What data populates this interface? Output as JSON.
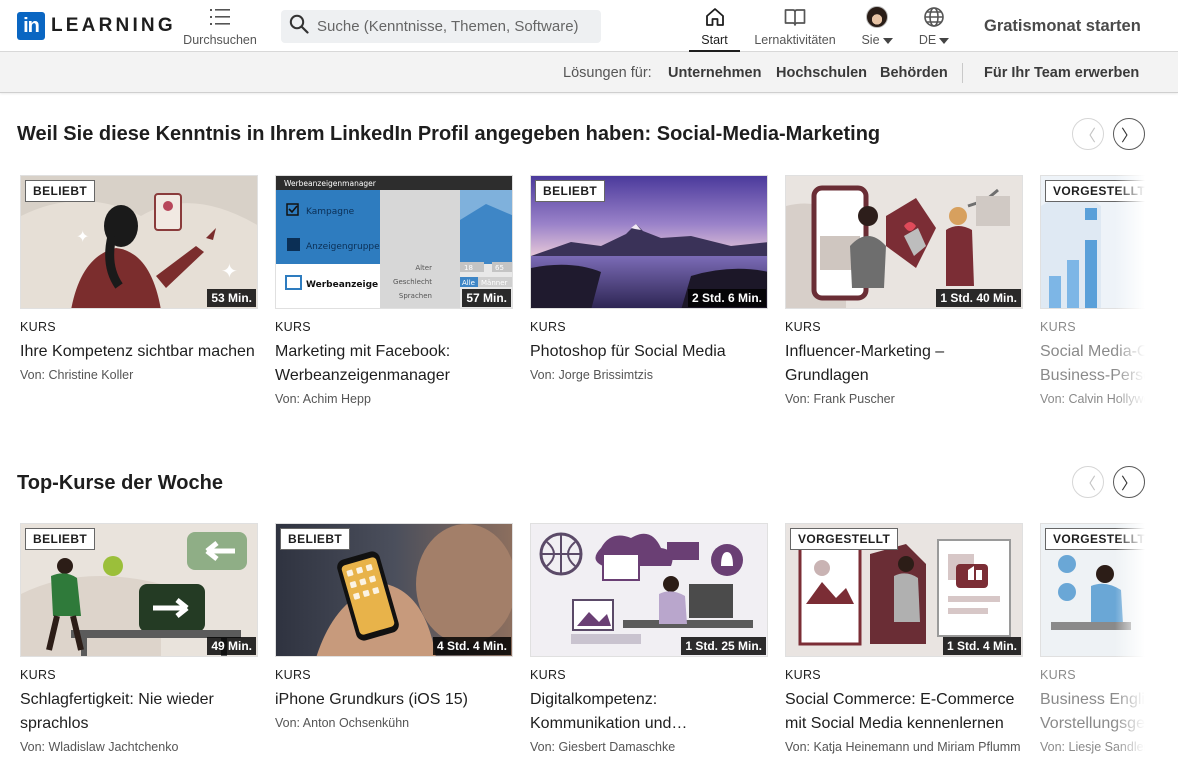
{
  "header": {
    "logo_box": "in",
    "logo_text": "LEARNING",
    "browse_label": "Durchsuchen",
    "search_placeholder": "Suche (Kenntnisse, Themen, Software)",
    "nav": {
      "start": "Start",
      "learning": "Lernaktivitäten",
      "me": "Sie",
      "lang": "DE"
    },
    "trial_label": "Gratismonat starten"
  },
  "subbar": {
    "solutions_label": "Lösungen für:",
    "links": [
      "Unternehmen",
      "Hochschulen",
      "Behörden"
    ],
    "team_link": "Für Ihr Team erwerben"
  },
  "sections": [
    {
      "title": "Weil Sie diese Kenntnis in Ihrem LinkedIn Profil angegeben haben: Social-Media-Marketing",
      "prev": "〈",
      "next": "〉",
      "cards": [
        {
          "badge": "BELIEBT",
          "duration": "53 Min.",
          "kind": "KURS",
          "title": "Ihre Kompetenz sichtbar machen",
          "author": "Von: Christine Koller"
        },
        {
          "badge": "",
          "duration": "57 Min.",
          "kind": "KURS",
          "title": "Marketing mit Facebook: Werbeanzeigenmanager",
          "author": "Von: Achim Hepp",
          "thumb_text": {
            "menu": "Werbeanzeigenmanager",
            "item1": "Kampagne",
            "item2": "Anzeigengruppe",
            "item3": "Werbeanzeige",
            "f1": "Alter",
            "f2": "Geschlecht",
            "f3": "Sprachen",
            "v1": "18",
            "v2": "65",
            "v3": "Alle",
            "v4": "Männer"
          }
        },
        {
          "badge": "BELIEBT",
          "duration": "2 Std. 6 Min.",
          "kind": "KURS",
          "title": "Photoshop für Social Media",
          "author": "Von: Jorge Brissimtzis"
        },
        {
          "badge": "",
          "duration": "1 Std. 40 Min.",
          "kind": "KURS",
          "title": "Influencer-Marketing – Grundlagen",
          "author": "Von: Frank Puscher"
        },
        {
          "badge": "VORGESTELLT",
          "duration": "",
          "kind": "KURS",
          "title": "Social Media-Content für Business-Personas",
          "author": "Von: Calvin Hollywood"
        }
      ]
    },
    {
      "title": "Top-Kurse der Woche",
      "prev": "〈",
      "next": "〉",
      "cards": [
        {
          "badge": "BELIEBT",
          "duration": "49 Min.",
          "kind": "KURS",
          "title": "Schlagfertigkeit: Nie wieder sprachlos",
          "author": "Von: Wladislaw Jachtchenko"
        },
        {
          "badge": "BELIEBT",
          "duration": "4 Std. 4 Min.",
          "kind": "KURS",
          "title": "iPhone Grundkurs (iOS 15)",
          "author": "Von: Anton Ochsenkühn"
        },
        {
          "badge": "",
          "duration": "1 Std. 25 Min.",
          "kind": "KURS",
          "title": "Digitalkompetenz: Kommunikation und…",
          "author": "Von: Giesbert Damaschke"
        },
        {
          "badge": "VORGESTELLT",
          "duration": "1 Std. 4 Min.",
          "kind": "KURS",
          "title": "Social Commerce: E-Commerce mit Social Media kennenlernen",
          "author": "Von: Katja Heinemann und Miriam Pflumm"
        },
        {
          "badge": "VORGESTELLT",
          "duration": "",
          "kind": "KURS",
          "title": "Business English: Vorstellungsgespräche",
          "author": "Von: Liesje Sandler"
        }
      ]
    }
  ]
}
